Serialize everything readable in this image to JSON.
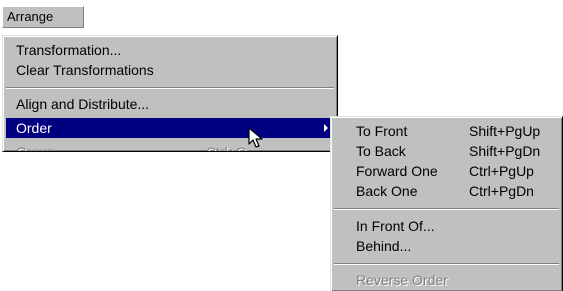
{
  "menubar": {
    "arrange_label": "Arrange"
  },
  "main_menu": {
    "transformation": "Transformation...",
    "clear_transformations": "Clear Transformations",
    "align_and_distribute": "Align and Distribute...",
    "order": "Order",
    "group": "Group",
    "group_shortcut": "Ctrl+G"
  },
  "order_submenu": {
    "to_front": {
      "label": "To Front",
      "shortcut": "Shift+PgUp"
    },
    "to_back": {
      "label": "To Back",
      "shortcut": "Shift+PgDn"
    },
    "forward_one": {
      "label": "Forward One",
      "shortcut": "Ctrl+PgUp"
    },
    "back_one": {
      "label": "Back One",
      "shortcut": "Ctrl+PgDn"
    },
    "in_front_of": "In Front Of...",
    "behind": "Behind...",
    "reverse_order": "Reverse Order"
  },
  "colors": {
    "menu_bg": "#c0c0c0",
    "highlight": "#000080",
    "disabled_text": "#808080"
  },
  "icons": {
    "cursor": "arrow-pointer-icon",
    "submenu": "submenu-arrow-icon"
  }
}
